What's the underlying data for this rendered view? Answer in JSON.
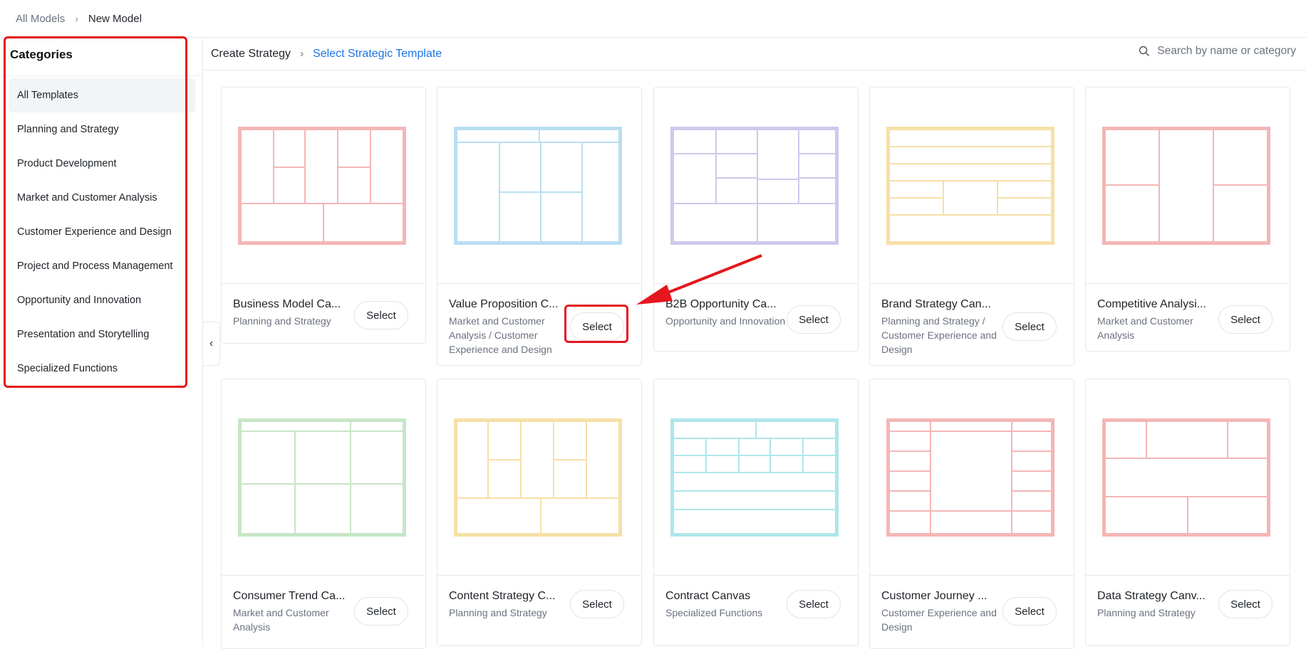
{
  "breadcrumb": {
    "root": "All Models",
    "current": "New Model"
  },
  "sidebar": {
    "title": "Categories",
    "items": [
      "All Templates",
      "Planning and Strategy",
      "Product Development",
      "Market and Customer Analysis",
      "Customer Experience and Design",
      "Project and Process Management",
      "Opportunity and Innovation",
      "Presentation and Storytelling",
      "Specialized Functions"
    ]
  },
  "header": {
    "step1": "Create Strategy",
    "step2": "Select Strategic Template"
  },
  "search": {
    "placeholder": "Search by name or category"
  },
  "select_label": "Select",
  "cards": [
    {
      "name": "Business Model Ca...",
      "category": "Planning and Strategy",
      "color": "#f4b6b6"
    },
    {
      "name": "Value Proposition C...",
      "category": "Market and Customer Analysis / Customer Experience and Design",
      "color": "#b9def2"
    },
    {
      "name": "B2B Opportunity Ca...",
      "category": "Opportunity and Innovation",
      "color": "#cfc8ec"
    },
    {
      "name": "Brand Strategy Can...",
      "category": "Planning and Strategy / Customer Experience and Design",
      "color": "#f6e0a6"
    },
    {
      "name": "Competitive Analysi...",
      "category": "Market and Customer Analysis",
      "color": "#f4b6b6"
    },
    {
      "name": "Consumer Trend Ca...",
      "category": "Market and Customer Analysis",
      "color": "#c7e6c7"
    },
    {
      "name": "Content Strategy C...",
      "category": "Planning and Strategy",
      "color": "#f6e0a6"
    },
    {
      "name": "Contract Canvas",
      "category": "Specialized Functions",
      "color": "#aee6ea"
    },
    {
      "name": "Customer Journey ...",
      "category": "Customer Experience and Design",
      "color": "#f4b6b6"
    },
    {
      "name": "Data Strategy Canv...",
      "category": "Planning and Strategy",
      "color": "#f4b6b6"
    }
  ],
  "colors": {
    "accent": "#1a73e8",
    "highlight": "#e5161d"
  }
}
